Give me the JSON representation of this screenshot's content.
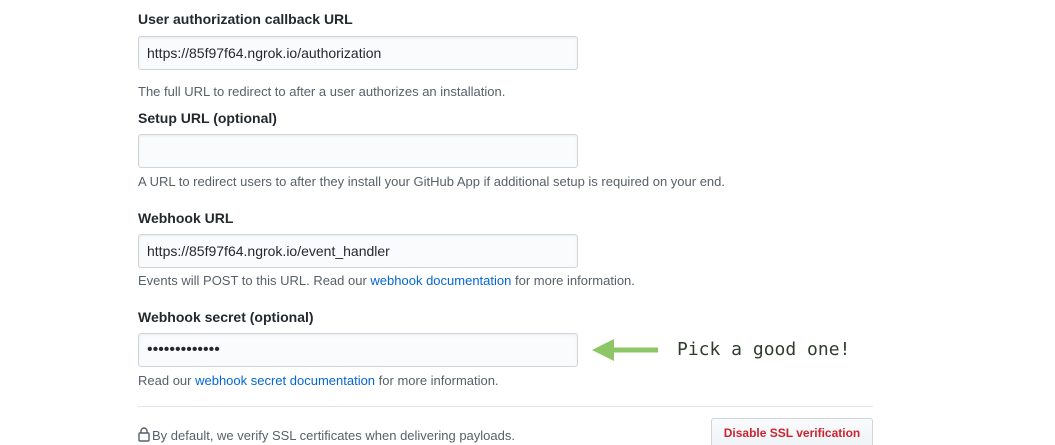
{
  "fields": {
    "callback": {
      "label": "User authorization callback URL",
      "value": "https://85f97f64.ngrok.io/authorization",
      "note": "The full URL to redirect to after a user authorizes an installation."
    },
    "setup": {
      "label": "Setup URL (optional)",
      "value": "",
      "note": "A URL to redirect users to after they install your GitHub App if additional setup is required on your end."
    },
    "webhook": {
      "label": "Webhook URL",
      "value": "https://85f97f64.ngrok.io/event_handler",
      "note_prefix": "Events will POST to this URL. Read our ",
      "note_link": "webhook documentation",
      "note_suffix": " for more information."
    },
    "secret": {
      "label": "Webhook secret (optional)",
      "value": "•••••••••••••",
      "note_prefix": "Read our ",
      "note_link": "webhook secret documentation",
      "note_suffix": " for more information."
    }
  },
  "annotation": {
    "text": "Pick a good one!",
    "arrow_color": "#8cc665",
    "icon": "left-arrow-icon"
  },
  "ssl": {
    "note": "By default, we verify SSL certificates when delivering payloads.",
    "button_label": "Disable SSL verification",
    "icon": "lock-icon"
  },
  "colors": {
    "link": "#0366d6",
    "danger": "#cb2431",
    "text": "#24292e",
    "muted": "#586069"
  }
}
